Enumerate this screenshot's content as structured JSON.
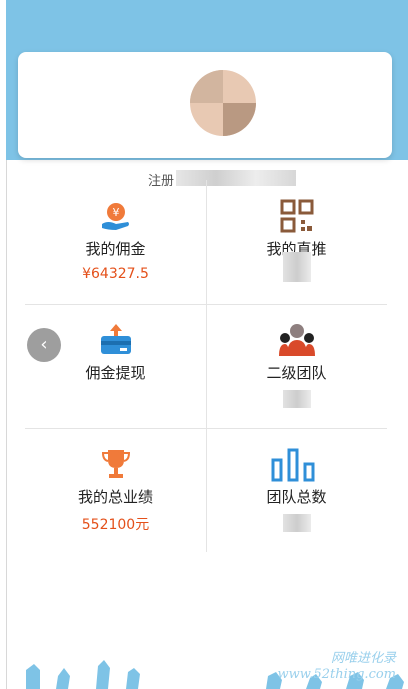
{
  "profile": {
    "registration_prefix": "注册"
  },
  "menu": [
    {
      "label": "我的佣金",
      "value": "¥64327.5"
    },
    {
      "label": "我的直推",
      "value": ""
    },
    {
      "label": "佣金提现",
      "value": ""
    },
    {
      "label": "二级团队",
      "value": ""
    },
    {
      "label": "我的总业绩",
      "value": "552100元"
    },
    {
      "label": "团队总数",
      "value": ""
    }
  ],
  "back_button": {
    "glyph": "‹"
  },
  "watermark": {
    "line1": "网唯进化录",
    "line2": "www.52thing.com"
  },
  "colors": {
    "accent": "#e4501a",
    "header": "#7ec3e6",
    "icon_blue": "#2f8fd8",
    "icon_orange": "#f07a3a"
  }
}
